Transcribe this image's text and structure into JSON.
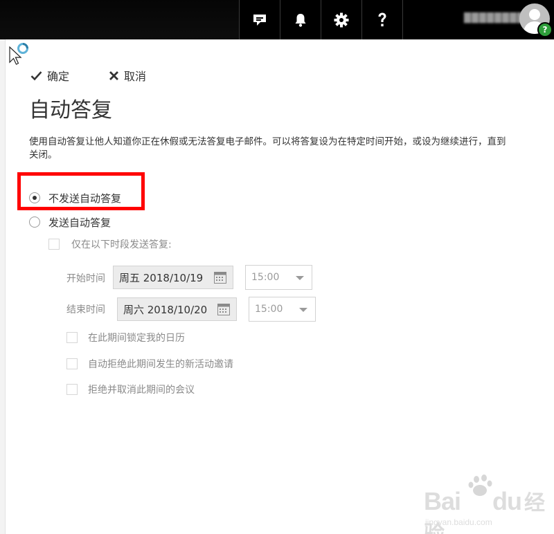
{
  "topbar": {
    "user_name": "████████u",
    "avatar_badge": "?"
  },
  "commands": {
    "ok_label": "确定",
    "cancel_label": "取消"
  },
  "title": "自动答复",
  "description": "使用自动答复让他人知道你正在休假或无法答复电子邮件。可以将答复设为在特定时间开始，或设为继续进行，直到\n关闭。",
  "options": {
    "dont_send": "不发送自动答复",
    "send": "发送自动答复",
    "only_during": "仅在以下时段发送答复:"
  },
  "schedule": {
    "start_label": "开始时间",
    "start_date": "周五 2018/10/19",
    "start_time": "15:00",
    "end_label": "结束时间",
    "end_date": "周六 2018/10/20",
    "end_time": "15:00"
  },
  "extra_options": {
    "block_calendar": "在此期间锁定我的日历",
    "decline_new": "自动拒绝此期间发生的新活动邀请",
    "decline_cancel": "拒绝并取消此期间的会议"
  },
  "watermark": {
    "brand": "Bai",
    "brand2": "du",
    "suffix": "经验",
    "url": "jingyan.baidu.com"
  },
  "colors": {
    "topbar": "#000000",
    "highlight": "#ff0000",
    "help_badge": "#2e9e3a"
  }
}
